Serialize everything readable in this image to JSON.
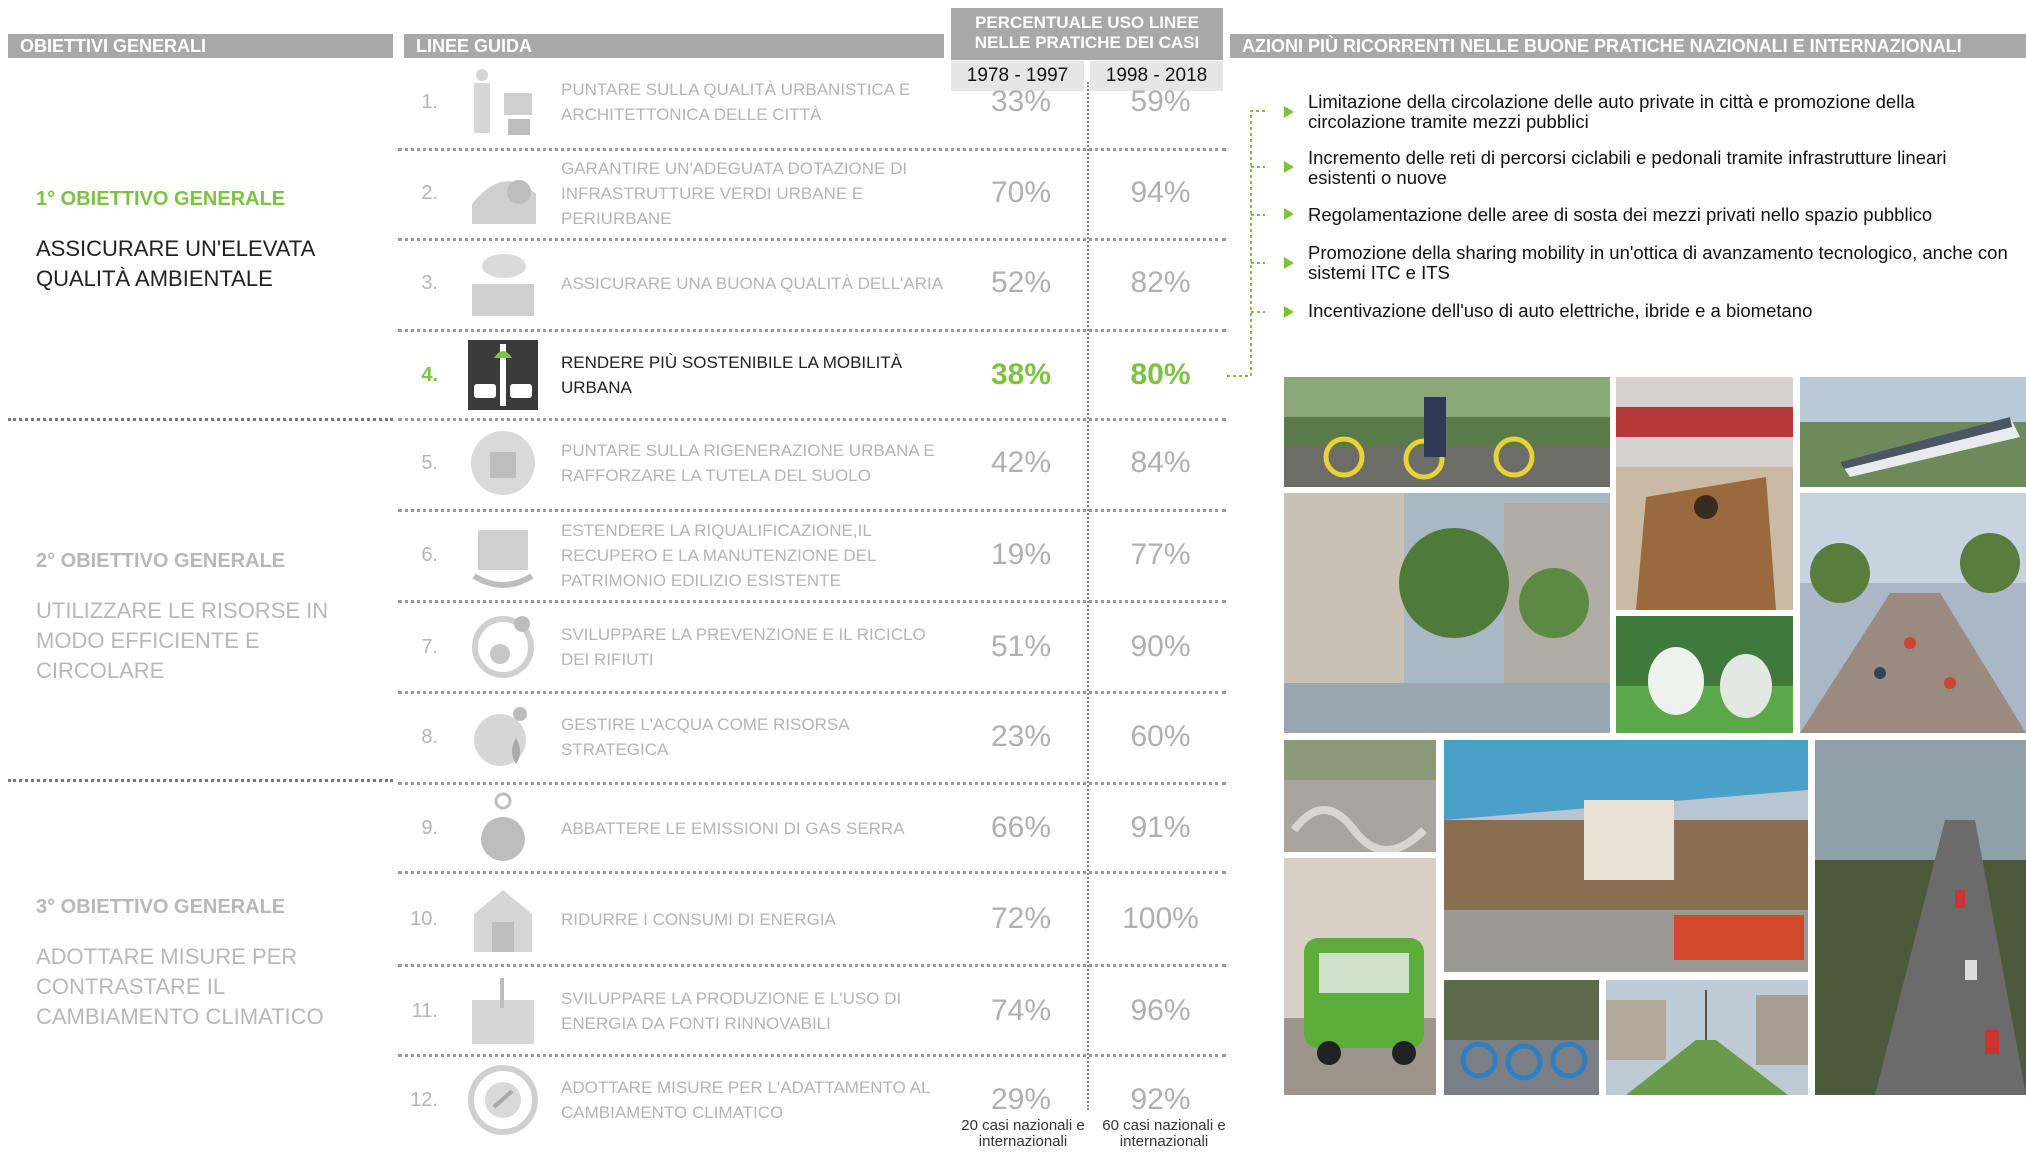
{
  "headers": {
    "objectives": "OBIETTIVI GENERALI",
    "guidelines": "LINEE GUIDA",
    "percentage": "PERCENTUALE USO LINEE NELLE PRATICHE DEI CASI",
    "actions": "AZIONI PIÙ RICORRENTI NELLE BUONE PRATICHE NAZIONALI E INTERNAZIONALI"
  },
  "periods": [
    "1978 - 1997",
    "1998 - 2018"
  ],
  "objectives": [
    {
      "title": "1° OBIETTIVO GENERALE",
      "text": "ASSICURARE UN'ELEVATA QUALITÀ AMBIENTALE"
    },
    {
      "title": "2° OBIETTIVO GENERALE",
      "text": "UTILIZZARE LE RISORSE IN MODO EFFICIENTE E CIRCOLARE"
    },
    {
      "title": "3° OBIETTIVO GENERALE",
      "text": "ADOTTARE MISURE PER CONTRASTARE IL CAMBIAMENTO CLIMATICO"
    }
  ],
  "guidelines": [
    {
      "num": "1.",
      "text": "PUNTARE SULLA QUALITÀ URBANISTICA E ARCHITETTONICA DELLE CITTÀ",
      "p1": "33%",
      "p2": "59%",
      "icon": "building-icon"
    },
    {
      "num": "2.",
      "text": "GARANTIRE UN'ADEGUATA DOTAZIONE DI INFRASTRUTTURE VERDI URBANE E PERIURBANE",
      "p1": "70%",
      "p2": "94%",
      "icon": "green-infrastructure-icon"
    },
    {
      "num": "3.",
      "text": "ASSICURARE UNA BUONA QUALITÀ DELL'ARIA",
      "p1": "52%",
      "p2": "82%",
      "icon": "air-quality-icon"
    },
    {
      "num": "4.",
      "text": "RENDERE PIÙ SOSTENIBILE LA MOBILITÀ URBANA",
      "p1": "38%",
      "p2": "80%",
      "icon": "mobility-icon"
    },
    {
      "num": "5.",
      "text": "PUNTARE SULLA RIGENERAZIONE URBANA E RAFFORZARE LA TUTELA DEL SUOLO",
      "p1": "42%",
      "p2": "84%",
      "icon": "regeneration-icon"
    },
    {
      "num": "6.",
      "text": "ESTENDERE LA RIQUALIFICAZIONE,IL RECUPERO E LA MANUTENZIONE DEL PATRIMONIO EDILIZIO ESISTENTE",
      "p1": "19%",
      "p2": "77%",
      "icon": "renovation-icon"
    },
    {
      "num": "7.",
      "text": "SVILUPPARE LA PREVENZIONE E IL RICICLO DEI RIFIUTI",
      "p1": "51%",
      "p2": "90%",
      "icon": "recycling-icon"
    },
    {
      "num": "8.",
      "text": "GESTIRE L'ACQUA COME RISORSA STRATEGICA",
      "p1": "23%",
      "p2": "60%",
      "icon": "water-icon"
    },
    {
      "num": "9.",
      "text": "ABBATTERE LE EMISSIONI DI GAS SERRA",
      "p1": "66%",
      "p2": "91%",
      "icon": "globe-icon"
    },
    {
      "num": "10.",
      "text": "RIDURRE I CONSUMI DI ENERGIA",
      "p1": "72%",
      "p2": "100%",
      "icon": "energy-house-icon"
    },
    {
      "num": "11.",
      "text": "SVILUPPARE LA PRODUZIONE E L'USO DI ENERGIA DA FONTI RINNOVABILI",
      "p1": "74%",
      "p2": "96%",
      "icon": "renewable-energy-icon"
    },
    {
      "num": "12.",
      "text": "ADOTTARE MISURE PER L'ADATTAMENTO AL CAMBIAMENTO CLIMATICO",
      "p1": "29%",
      "p2": "92%",
      "icon": "adaptation-icon"
    }
  ],
  "highlight_color": "#7ec242",
  "footnotes": [
    "20 casi nazionali e internazionali",
    "60 casi nazionali e internazionali"
  ],
  "actions": [
    "Limitazione della circolazione delle auto private in città e promozione della circolazione tramite mezzi pubblici",
    "Incremento delle reti di percorsi ciclabili e pedonali tramite infrastrutture lineari esistenti o nuove",
    "Regolamentazione delle aree di sosta dei mezzi privati nello spazio pubblico",
    "Promozione della sharing mobility in un'ottica di avanzamento tecnologico, anche con sistemi ITC e ITS",
    "Incentivazione dell'uso di auto elettriche, ibride e a biometano"
  ]
}
